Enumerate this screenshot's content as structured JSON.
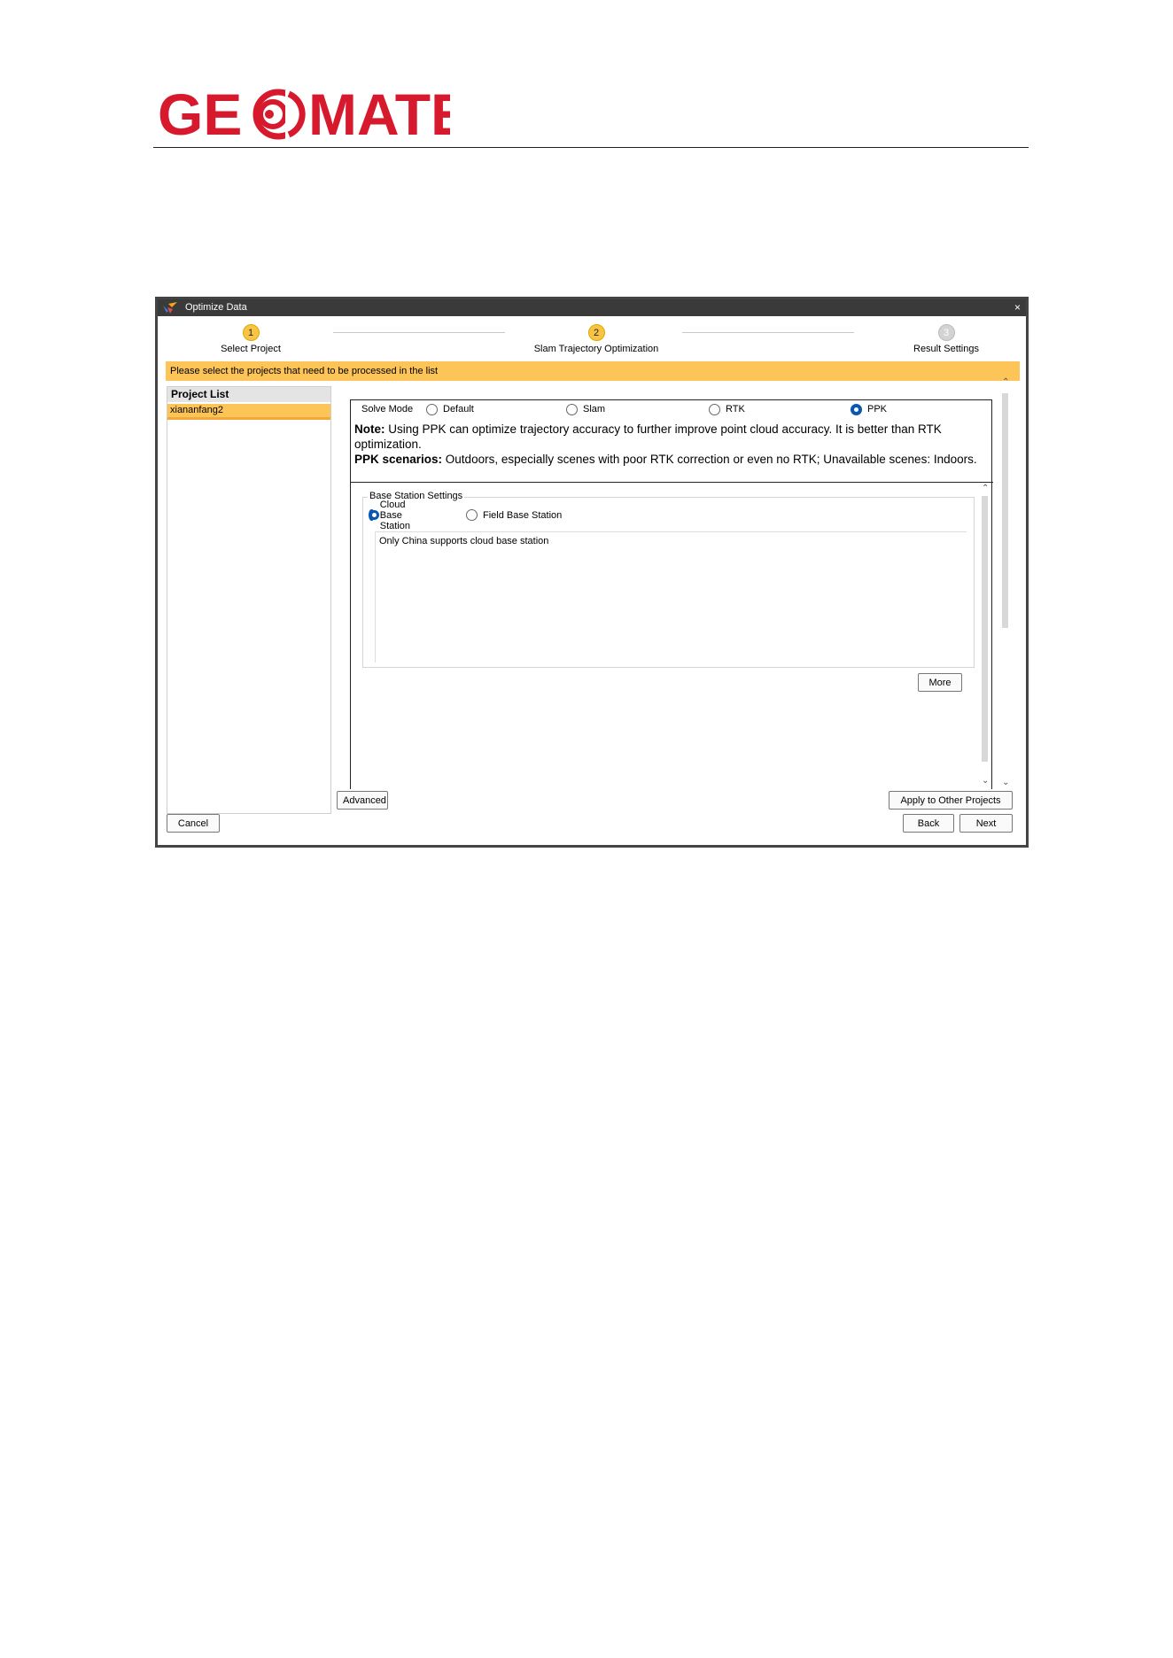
{
  "brand": {
    "name": "GEOMATE"
  },
  "dialog": {
    "title": "Optimize Data",
    "close_glyph": "×",
    "steps": [
      {
        "num": "1",
        "label": "Select Project",
        "state": "active"
      },
      {
        "num": "2",
        "label": "Slam Trajectory Optimization",
        "state": "active"
      },
      {
        "num": "3",
        "label": "Result Settings",
        "state": "inactive"
      }
    ],
    "banner": "Please select the projects that need to be processed in the list",
    "project_list": {
      "header": "Project List",
      "items": [
        "xiananfang2"
      ]
    },
    "solve_mode": {
      "label": "Solve Mode",
      "options": [
        "Default",
        "Slam",
        "RTK",
        "PPK"
      ],
      "selected": "PPK"
    },
    "note": {
      "label": "Note:",
      "text": " Using PPK can optimize trajectory accuracy to further improve point cloud accuracy. It is better than RTK optimization."
    },
    "scenarios": {
      "label": "PPK scenarios:",
      "text": " Outdoors, especially scenes with poor RTK correction or even no RTK; Unavailable scenes: Indoors."
    },
    "base_station": {
      "title": "Base Station Settings",
      "options": [
        "Cloud Base Station",
        "Field Base Station"
      ],
      "selected": "Cloud Base Station",
      "info": "Only China supports cloud base station"
    },
    "buttons": {
      "more": "More",
      "advanced": "Advanced",
      "apply_other": "Apply to Other Projects",
      "cancel": "Cancel",
      "back": "Back",
      "next": "Next"
    },
    "accent_color": "#fdc457",
    "radio_color": "#0a57b0"
  }
}
